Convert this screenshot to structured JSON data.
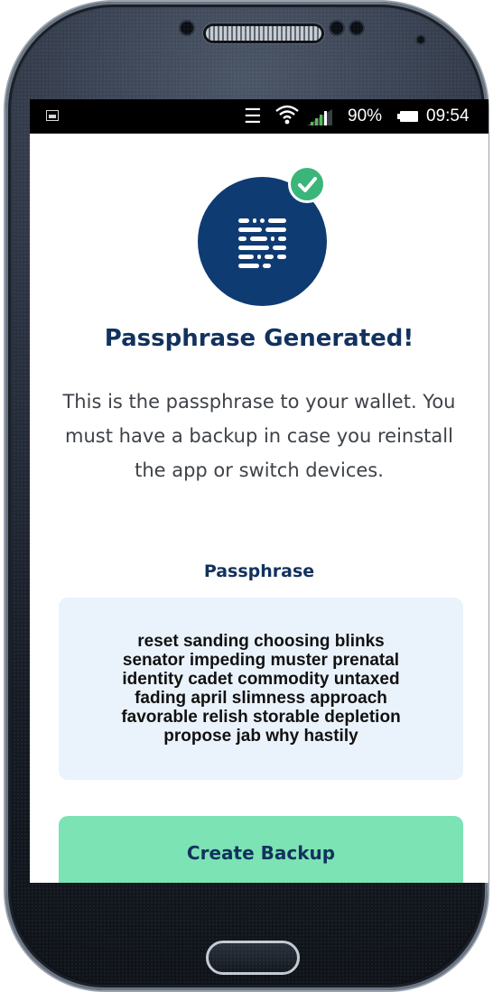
{
  "status_bar": {
    "battery_percent": "90%",
    "time": "09:54",
    "icons": [
      "gallery-icon",
      "vibrate-icon",
      "wifi-icon",
      "signal-icon",
      "battery-icon"
    ]
  },
  "header": {
    "title": "Passphrase Generated!",
    "badge_icon": "document-lines-icon",
    "check_icon": "checkmark-icon"
  },
  "main": {
    "description": "This is the passphrase to your wallet. You must have a backup in case you reinstall the app or switch devices.",
    "passphrase_label": "Passphrase",
    "passphrase_lines": [
      "reset sanding choosing blinks",
      "senator impeding muster prenatal",
      "identity cadet commodity untaxed",
      "fading april slimness approach",
      "favorable relish storable depletion",
      "propose jab why hastily"
    ],
    "create_backup_label": "Create Backup"
  },
  "colors": {
    "brand_navy": "#0f3b73",
    "title_navy": "#12325e",
    "success_green": "#3ab67a",
    "button_green": "#7ce3b4",
    "passphrase_bg": "#eaf3fc"
  }
}
